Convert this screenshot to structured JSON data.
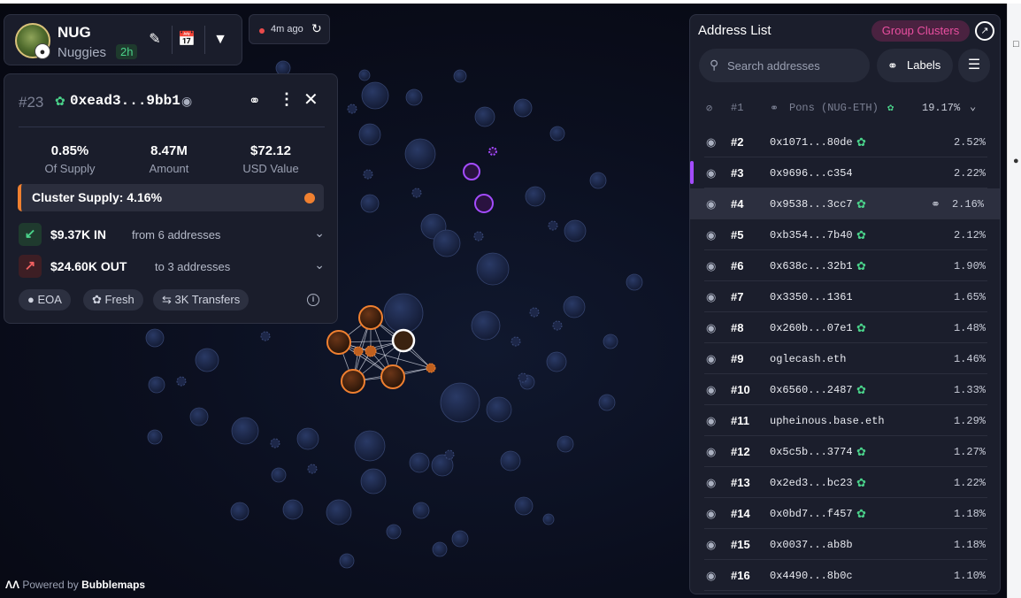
{
  "token": {
    "symbol": "NUG",
    "name": "Nuggies",
    "age": "2h"
  },
  "refresh": {
    "label": "4m ago"
  },
  "detail": {
    "rank": "#23",
    "address": "0xead3...9bb1",
    "stats": [
      {
        "value": "0.85%",
        "label": "Of Supply"
      },
      {
        "value": "8.47M",
        "label": "Amount"
      },
      {
        "value": "$72.12",
        "label": "USD Value"
      }
    ],
    "cluster": "Cluster Supply: 4.16%",
    "inflow": {
      "amount": "$9.37K IN",
      "from": "from 6 addresses"
    },
    "outflow": {
      "amount": "$24.60K OUT",
      "to": "to 3 addresses"
    },
    "chips": [
      "EOA",
      "Fresh",
      "3K Transfers"
    ]
  },
  "address_list": {
    "title": "Address List",
    "group_label": "Group Clusters",
    "search_placeholder": "Search addresses",
    "labels_label": "Labels",
    "pool": {
      "rank": "#1",
      "name": "Pons (NUG-ETH)",
      "pct": "19.17%"
    },
    "rows": [
      {
        "rank": "#2",
        "addr": "0x1071...80de",
        "fresh": true,
        "pct": "2.52%"
      },
      {
        "rank": "#3",
        "addr": "0x9696...c354",
        "fresh": false,
        "pct": "2.22%"
      },
      {
        "rank": "#4",
        "addr": "0x9538...3cc7",
        "fresh": true,
        "pct": "2.16%"
      },
      {
        "rank": "#5",
        "addr": "0xb354...7b40",
        "fresh": true,
        "pct": "2.12%"
      },
      {
        "rank": "#6",
        "addr": "0x638c...32b1",
        "fresh": true,
        "pct": "1.90%"
      },
      {
        "rank": "#7",
        "addr": "0x3350...1361",
        "fresh": false,
        "pct": "1.65%"
      },
      {
        "rank": "#8",
        "addr": "0x260b...07e1",
        "fresh": true,
        "pct": "1.48%"
      },
      {
        "rank": "#9",
        "addr": "oglecash.eth",
        "fresh": false,
        "pct": "1.46%"
      },
      {
        "rank": "#10",
        "addr": "0x6560...2487",
        "fresh": true,
        "pct": "1.33%"
      },
      {
        "rank": "#11",
        "addr": "upheinous.base.eth",
        "fresh": false,
        "pct": "1.29%"
      },
      {
        "rank": "#12",
        "addr": "0x5c5b...3774",
        "fresh": true,
        "pct": "1.27%"
      },
      {
        "rank": "#13",
        "addr": "0x2ed3...bc23",
        "fresh": true,
        "pct": "1.22%"
      },
      {
        "rank": "#14",
        "addr": "0x0bd7...f457",
        "fresh": true,
        "pct": "1.18%"
      },
      {
        "rank": "#15",
        "addr": "0x0037...ab8b",
        "fresh": false,
        "pct": "1.18%"
      },
      {
        "rank": "#16",
        "addr": "0x4490...8b0c",
        "fresh": false,
        "pct": "1.10%"
      }
    ]
  },
  "footer": {
    "powered_by": "Powered by",
    "brand": "Bubblemaps"
  },
  "colors": {
    "accent_orange": "#f08030",
    "fresh_green": "#4ad28a",
    "group_pink": "#e94fa0",
    "selected_purple": "#a44cff"
  }
}
